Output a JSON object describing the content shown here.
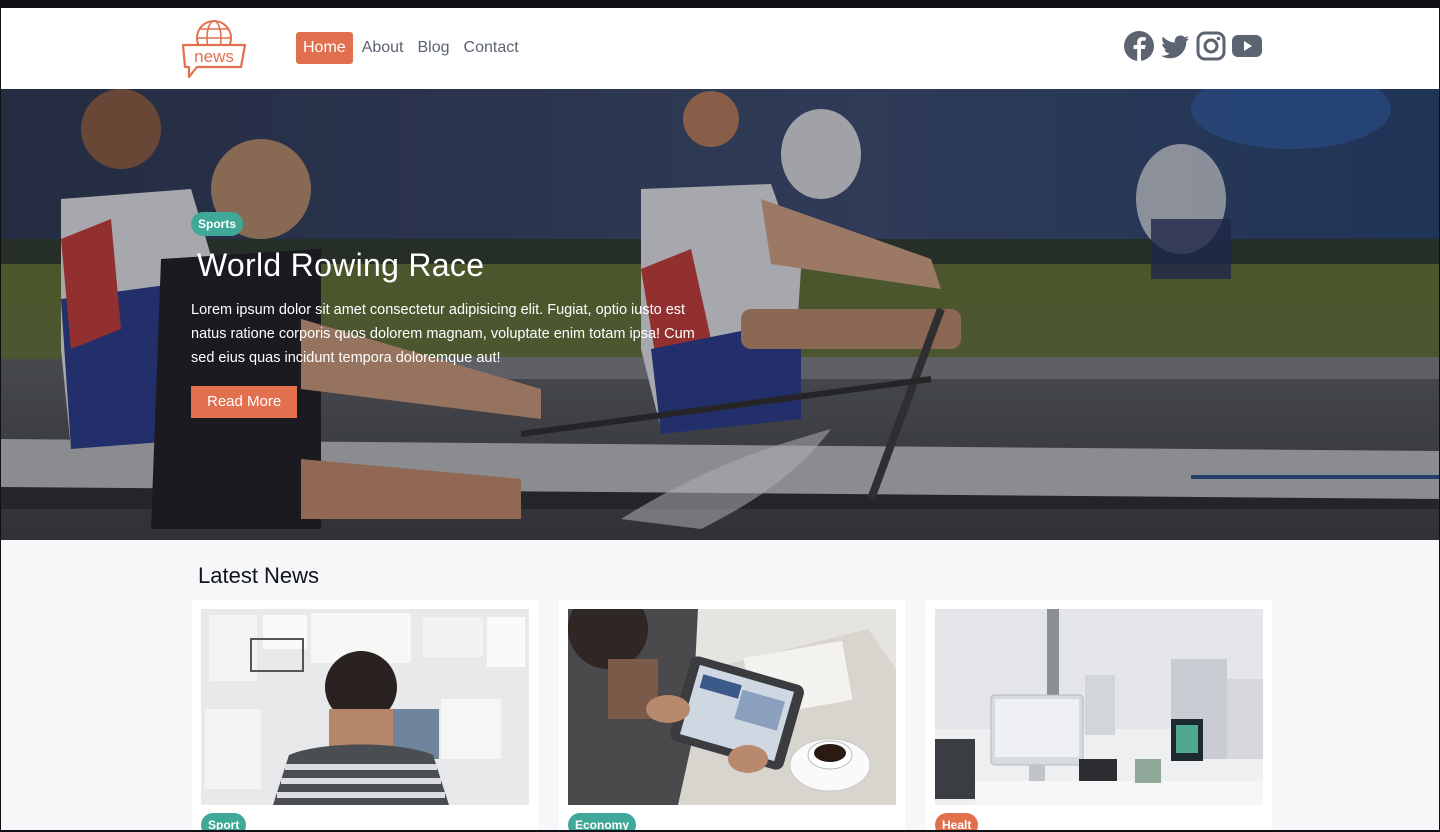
{
  "header": {
    "logo_text": "news",
    "nav": [
      {
        "label": "Home",
        "active": true
      },
      {
        "label": "About",
        "active": false
      },
      {
        "label": "Blog",
        "active": false
      },
      {
        "label": "Contact",
        "active": false
      }
    ],
    "social": [
      "facebook-icon",
      "twitter-icon",
      "instagram-icon",
      "youtube-icon"
    ]
  },
  "hero": {
    "category": "Sports",
    "title": "World Rowing Race",
    "text": "Lorem ipsum dolor sit amet consectetur adipisicing elit. Fugiat, optio iusto est natus ratione corporis quos dolorem magnam, voluptate enim totam ipsa! Cum sed eius quas incidunt tempora doloremque aut!",
    "button_label": "Read More"
  },
  "latest": {
    "title": "Latest News",
    "cards": [
      {
        "category": "Sport",
        "badge_color": "#3fa898"
      },
      {
        "category": "Economy",
        "badge_color": "#3fa898"
      },
      {
        "category": "Healt",
        "badge_color": "#e2704e"
      }
    ]
  },
  "colors": {
    "accent": "#e2704e",
    "teal": "#3fa898"
  }
}
